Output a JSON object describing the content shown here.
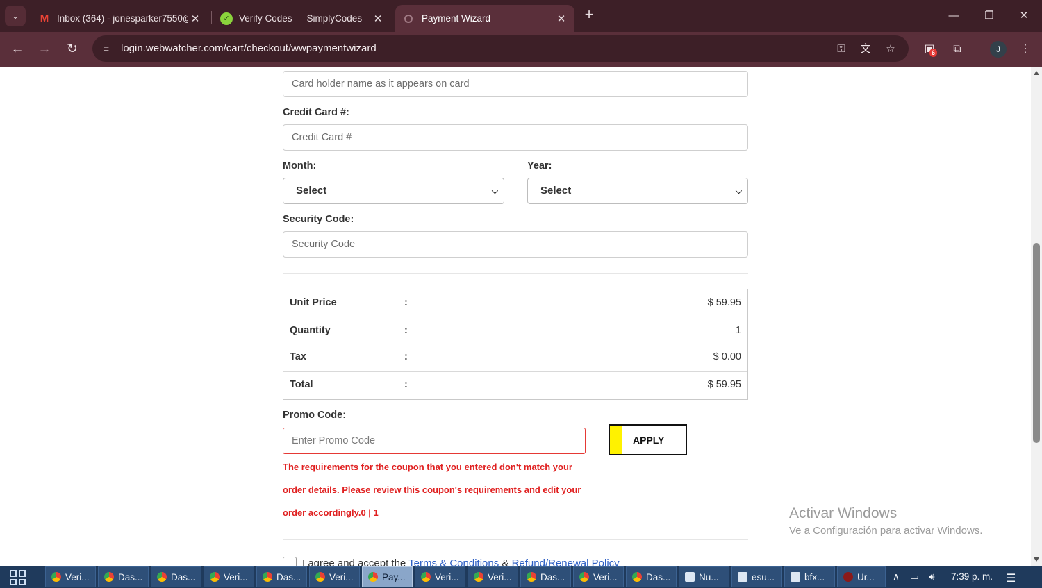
{
  "browser": {
    "tabs": [
      {
        "title": "Inbox (364) - jonesparker7550@",
        "favicon": "gmail-icon",
        "active": false
      },
      {
        "title": "Verify Codes — SimplyCodes",
        "favicon": "simplycodes-icon",
        "active": false
      },
      {
        "title": "Payment Wizard",
        "favicon": "loading-icon",
        "active": true
      }
    ],
    "url": "login.webwatcher.com/cart/checkout/wwpaymentwizard",
    "extension_badge": "6",
    "profile_initial": "J"
  },
  "form": {
    "cardholder_placeholder": "Card holder name as it appears on card",
    "credit_card_label": "Credit Card #:",
    "credit_card_placeholder": "Credit Card #",
    "month_label": "Month:",
    "month_value": "Select",
    "year_label": "Year:",
    "year_value": "Select",
    "security_label": "Security Code:",
    "security_placeholder": "Security Code"
  },
  "summary": {
    "separator": ":",
    "rows": [
      {
        "label": "Unit Price",
        "value": "$ 59.95"
      },
      {
        "label": "Quantity",
        "value": "1"
      },
      {
        "label": "Tax",
        "value": "$ 0.00"
      },
      {
        "label": "Total",
        "value": "$ 59.95"
      }
    ]
  },
  "promo": {
    "label": "Promo Code:",
    "placeholder": "Enter Promo Code",
    "apply_label": "APPLY",
    "error_lines": [
      "The requirements for the coupon that you entered don't match your",
      "order details. Please review this coupon's requirements and edit your",
      "order accordingly.0 | 1"
    ]
  },
  "terms": {
    "prefix": "I agree and  accept  the ",
    "link1": "Terms & Conditions",
    "middle": " & ",
    "link2": "Refund/Renewal Policy"
  },
  "watermark": {
    "title": "Activar Windows",
    "subtitle": "Ve a Configuración para activar Windows."
  },
  "taskbar": {
    "buttons": [
      {
        "label": "Veri...",
        "icon": "chrome-icon"
      },
      {
        "label": "Das...",
        "icon": "chrome-icon"
      },
      {
        "label": "Das...",
        "icon": "chrome-icon"
      },
      {
        "label": "Veri...",
        "icon": "chrome-icon"
      },
      {
        "label": "Das...",
        "icon": "chrome-icon"
      },
      {
        "label": "Veri...",
        "icon": "chrome-icon"
      },
      {
        "label": "Pay...",
        "icon": "chrome-icon",
        "active": true
      },
      {
        "label": "Veri...",
        "icon": "chrome-icon"
      },
      {
        "label": "Veri...",
        "icon": "chrome-icon"
      },
      {
        "label": "Das...",
        "icon": "chrome-icon"
      },
      {
        "label": "Veri...",
        "icon": "chrome-icon"
      },
      {
        "label": "Das...",
        "icon": "chrome-icon"
      },
      {
        "label": "Nu...",
        "icon": "notepad-icon"
      },
      {
        "label": "esu...",
        "icon": "notepad-icon"
      },
      {
        "label": "bfx...",
        "icon": "notepad-icon"
      },
      {
        "label": "Ur...",
        "icon": "app-icon"
      }
    ],
    "clock": "7:39 p. m."
  },
  "colors": {
    "tabstrip": "#3d1f27",
    "toolbar": "#5a2f3a",
    "error": "#e02020",
    "apply_accent": "#fff200",
    "taskbar": "#1f3a5c"
  }
}
